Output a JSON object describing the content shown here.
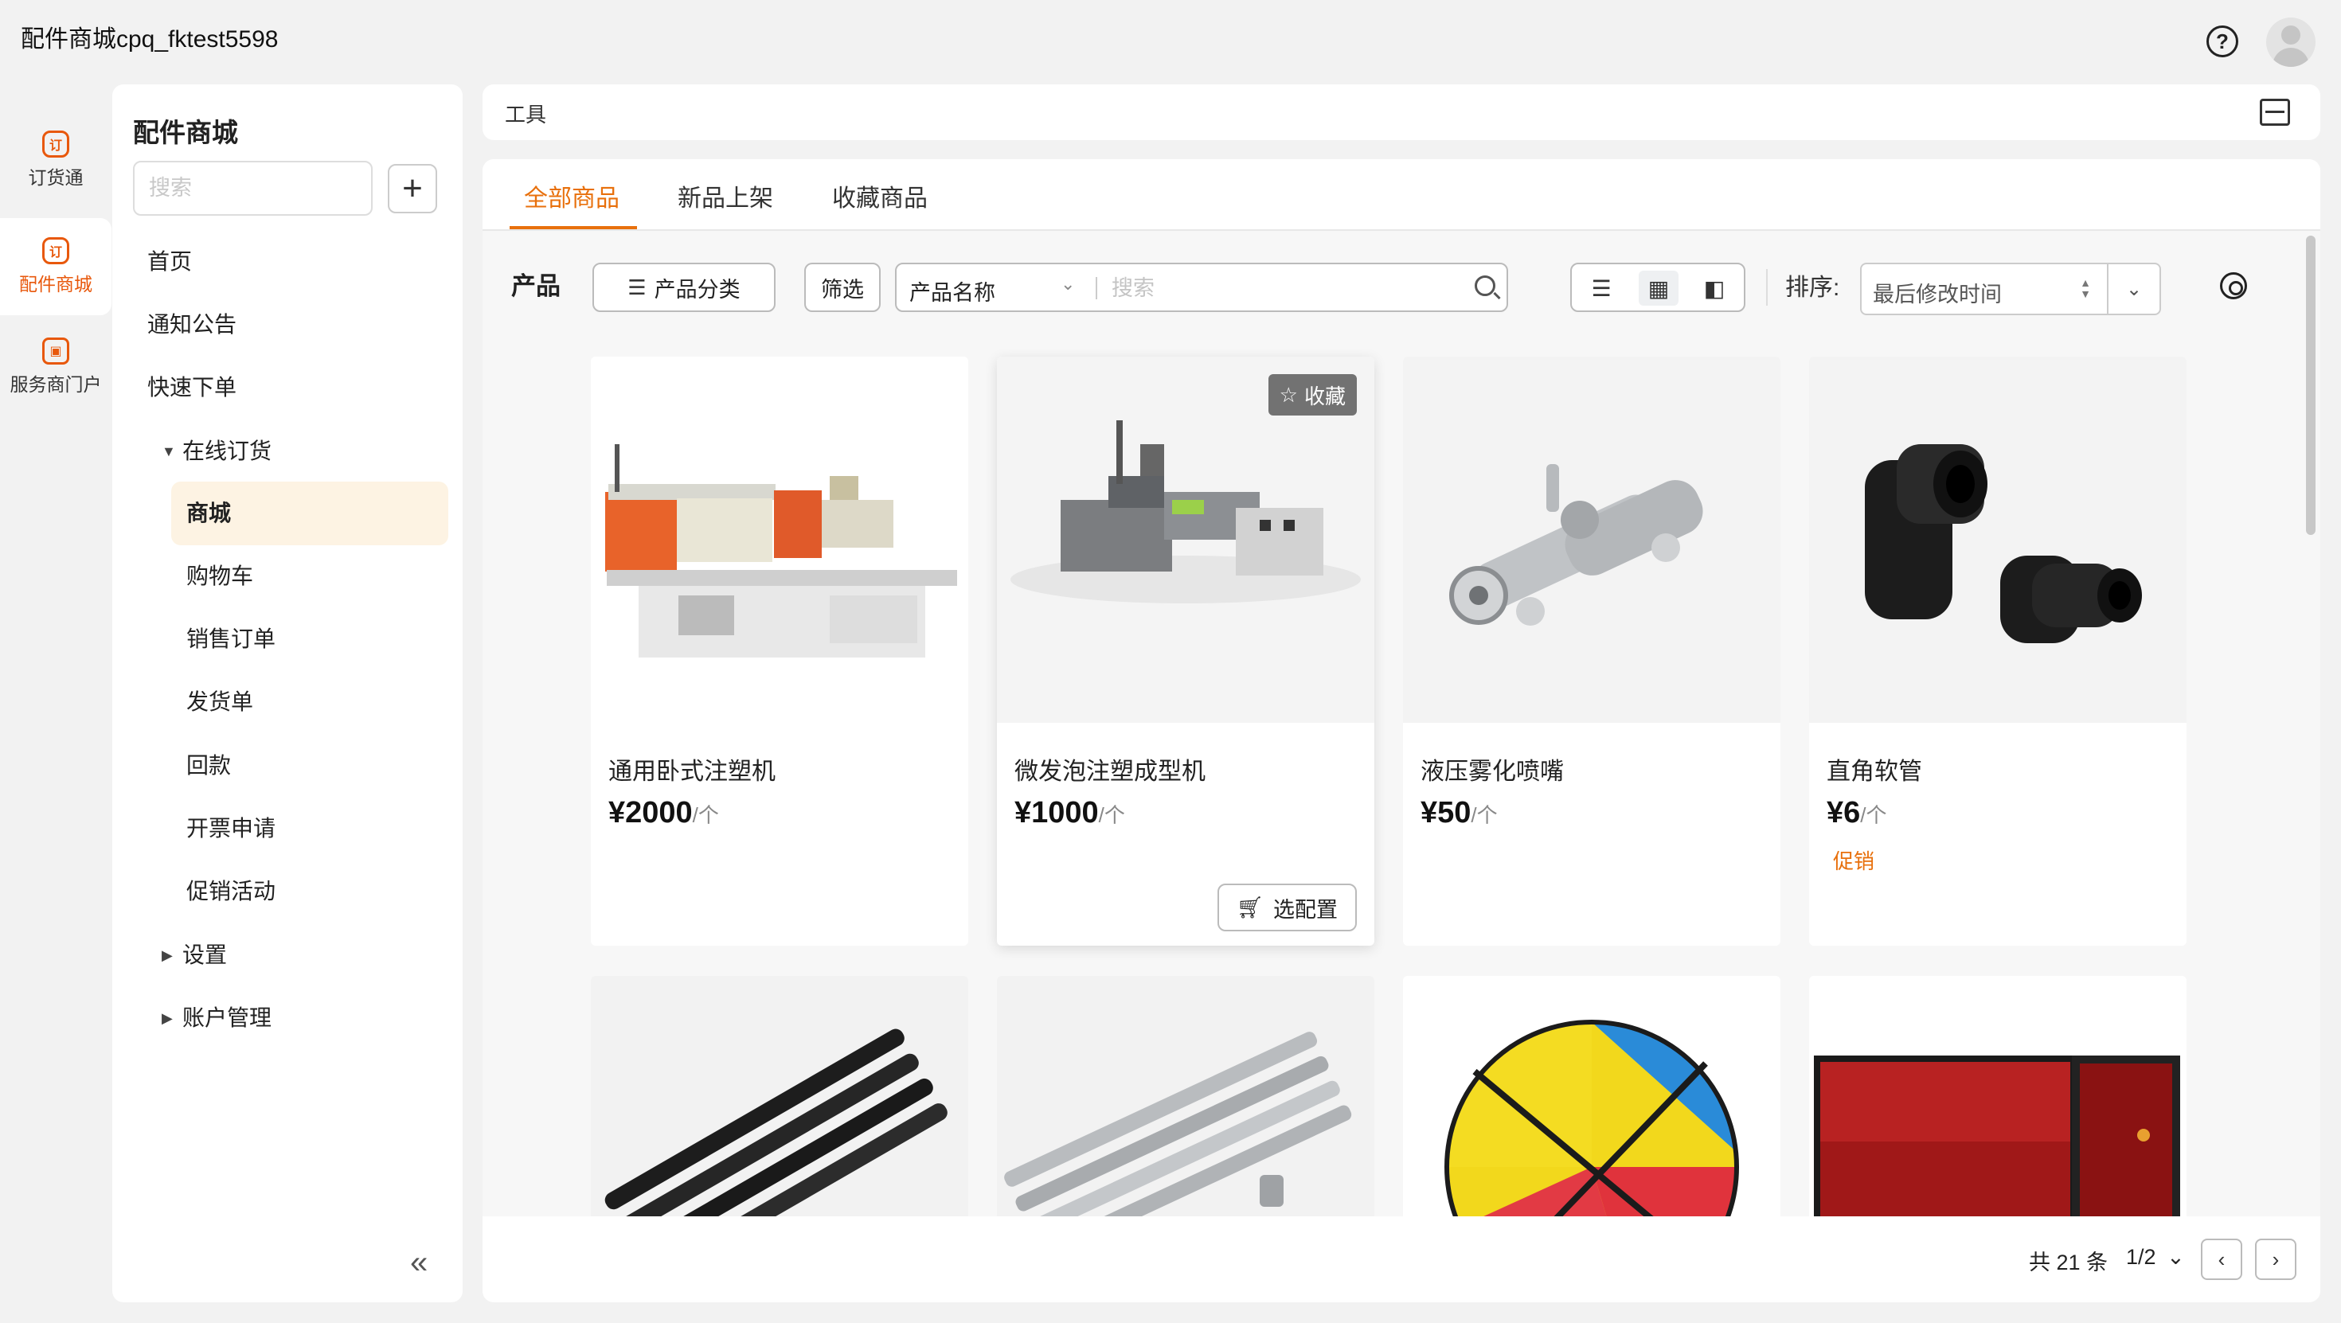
{
  "app": {
    "title": "配件商城cpq_fktest5598"
  },
  "rail": {
    "items": [
      {
        "label": "订货通",
        "icon": "订",
        "active": false
      },
      {
        "label": "配件商城",
        "icon": "订",
        "active": true
      },
      {
        "label": "服务商门户",
        "icon": "▣",
        "active": false
      }
    ]
  },
  "nav": {
    "title": "配件商城",
    "search_placeholder": "搜索",
    "add_label": "+",
    "items": [
      {
        "label": "首页"
      },
      {
        "label": "通知公告"
      },
      {
        "label": "快速下单"
      },
      {
        "label": "在线订货",
        "expanded": true
      },
      {
        "label": "商城",
        "active": true
      },
      {
        "label": "购物车"
      },
      {
        "label": "销售订单"
      },
      {
        "label": "发货单"
      },
      {
        "label": "回款"
      },
      {
        "label": "开票申请"
      },
      {
        "label": "促销活动"
      },
      {
        "label": "设置",
        "expanded": false
      },
      {
        "label": "账户管理",
        "expanded": false
      }
    ],
    "collapse_label": "«"
  },
  "tools": {
    "label": "工具"
  },
  "tabs": [
    {
      "label": "全部商品",
      "active": true
    },
    {
      "label": "新品上架",
      "active": false
    },
    {
      "label": "收藏商品",
      "active": false
    }
  ],
  "filter": {
    "title": "产品",
    "category_label": "产品分类",
    "filter_label": "筛选",
    "field_select": "产品名称",
    "search_placeholder": "搜索",
    "sort_label": "排序:",
    "sort_value": "最后修改时间"
  },
  "products": [
    {
      "name": "通用卧式注塑机",
      "price": "¥2000",
      "unit": "/个",
      "tag": ""
    },
    {
      "name": "微发泡注塑成型机",
      "price": "¥1000",
      "unit": "/个",
      "tag": "",
      "fav_label": "收藏",
      "config_label": "选配置"
    },
    {
      "name": "液压雾化喷嘴",
      "price": "¥50",
      "unit": "/个",
      "tag": ""
    },
    {
      "name": "直角软管",
      "price": "¥6",
      "unit": "/个",
      "tag": "促销"
    },
    {
      "name": ""
    },
    {
      "name": ""
    },
    {
      "name": ""
    },
    {
      "name": ""
    }
  ],
  "pager": {
    "total": "共 21 条",
    "page": "1/2"
  },
  "colors": {
    "accent": "#e8700c",
    "active_bg": "#fdf3e3"
  }
}
